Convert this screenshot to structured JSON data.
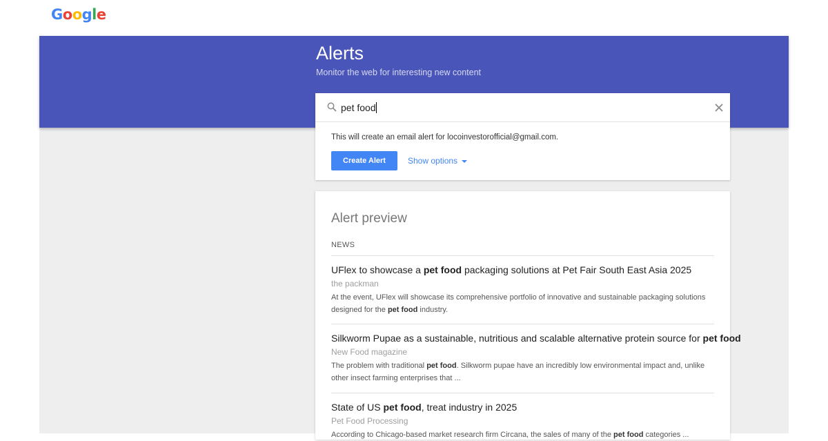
{
  "logo": {
    "letters": [
      {
        "char": "G",
        "color": "#4285f4"
      },
      {
        "char": "o",
        "color": "#ea4335"
      },
      {
        "char": "o",
        "color": "#fbbc05"
      },
      {
        "char": "g",
        "color": "#4285f4"
      },
      {
        "char": "l",
        "color": "#34a853"
      },
      {
        "char": "e",
        "color": "#ea4335"
      }
    ]
  },
  "colors": {
    "hero_bg": "#4a55b9",
    "accent": "#4285f4",
    "page_bg": "#eeeeee"
  },
  "header": {
    "title": "Alerts",
    "subtitle": "Monitor the web for interesting new content"
  },
  "search": {
    "value": "pet food",
    "icon": "search-icon",
    "clear_icon": "close-icon"
  },
  "alert_setup": {
    "email_note": "This will create an email alert for locoinvestorofficial@gmail.com.",
    "create_label": "Create Alert",
    "options_label": "Show options",
    "options_icon": "caret-down-icon"
  },
  "preview": {
    "title": "Alert preview",
    "section": "NEWS",
    "items": [
      {
        "title_parts": [
          "UFlex to showcase a ",
          "pet food",
          " packaging solutions at Pet Fair South East Asia 2025"
        ],
        "source": "the packman",
        "snippet_parts": [
          "At the event, UFlex will showcase its comprehensive portfolio of innovative and sustainable packaging solutions designed for the ",
          "pet food",
          " industry."
        ]
      },
      {
        "title_parts": [
          "Silkworm Pupae as a sustainable, nutritious and scalable alternative protein source for ",
          "pet food",
          ""
        ],
        "source": "New Food magazine",
        "snippet_parts": [
          "The problem with traditional ",
          "pet food",
          ". Silkworm pupae have an incredibly low environmental impact and, unlike other insect farming enterprises that ..."
        ]
      },
      {
        "title_parts": [
          "State of US ",
          "pet food",
          ", treat industry in 2025"
        ],
        "source": "Pet Food Processing",
        "snippet_parts": [
          "According to Chicago-based market research firm Circana, the sales of many of the ",
          "pet food",
          " categories ..."
        ]
      }
    ]
  }
}
